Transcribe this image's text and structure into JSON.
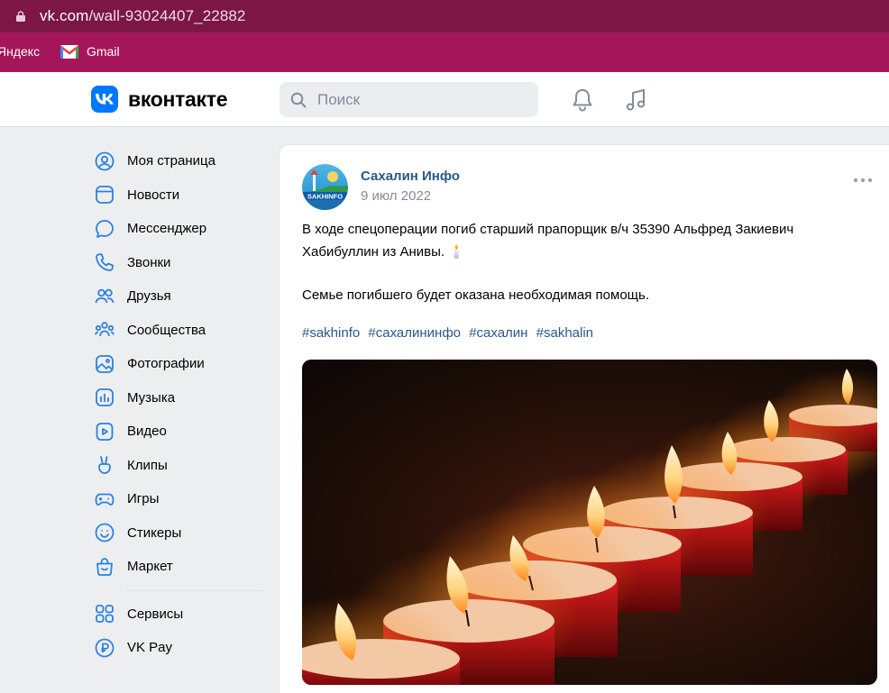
{
  "browser": {
    "url_host": "vk.com",
    "url_path": "/wall-93024407_22882",
    "bookmarks": [
      {
        "label": "Яндекс"
      },
      {
        "label": "Gmail"
      }
    ]
  },
  "header": {
    "logo_text": "вконтакте",
    "search_placeholder": "Поиск"
  },
  "sidebar": {
    "items": [
      {
        "label": "Моя страница",
        "icon": "user-circle-icon"
      },
      {
        "label": "Новости",
        "icon": "news-icon"
      },
      {
        "label": "Мессенджер",
        "icon": "message-icon"
      },
      {
        "label": "Звонки",
        "icon": "phone-icon"
      },
      {
        "label": "Друзья",
        "icon": "friends-icon"
      },
      {
        "label": "Сообщества",
        "icon": "communities-icon"
      },
      {
        "label": "Фотографии",
        "icon": "photo-icon"
      },
      {
        "label": "Музыка",
        "icon": "music-icon"
      },
      {
        "label": "Видео",
        "icon": "video-icon"
      },
      {
        "label": "Клипы",
        "icon": "clips-icon"
      },
      {
        "label": "Игры",
        "icon": "gamepad-icon"
      },
      {
        "label": "Стикеры",
        "icon": "sticker-icon"
      },
      {
        "label": "Маркет",
        "icon": "market-icon"
      }
    ],
    "secondary": [
      {
        "label": "Сервисы",
        "icon": "services-icon"
      },
      {
        "label": "VK Pay",
        "icon": "vkpay-icon"
      }
    ]
  },
  "post": {
    "author": "Сахалин Инфо",
    "avatar_text": "SAKHINFO",
    "date": "9 июл 2022",
    "text_line1": "В ходе спецоперации погиб старший прапорщик в/ч 35390 Альфред Закиевич Хабибуллин из Анивы. 🕯️",
    "text_line2": "Семье погибшего будет оказана необходимая помощь.",
    "hashtags": [
      "#sakhinfo",
      "#сахалининфо",
      "#сахалин",
      "#sakhalin"
    ]
  },
  "colors": {
    "chrome_top": "#7b1645",
    "bookmarks_bar": "#a5155a",
    "vk_blue": "#0077ff",
    "link": "#2a5885",
    "muted": "#818c99",
    "sidebar_icon": "#2d81e0"
  }
}
